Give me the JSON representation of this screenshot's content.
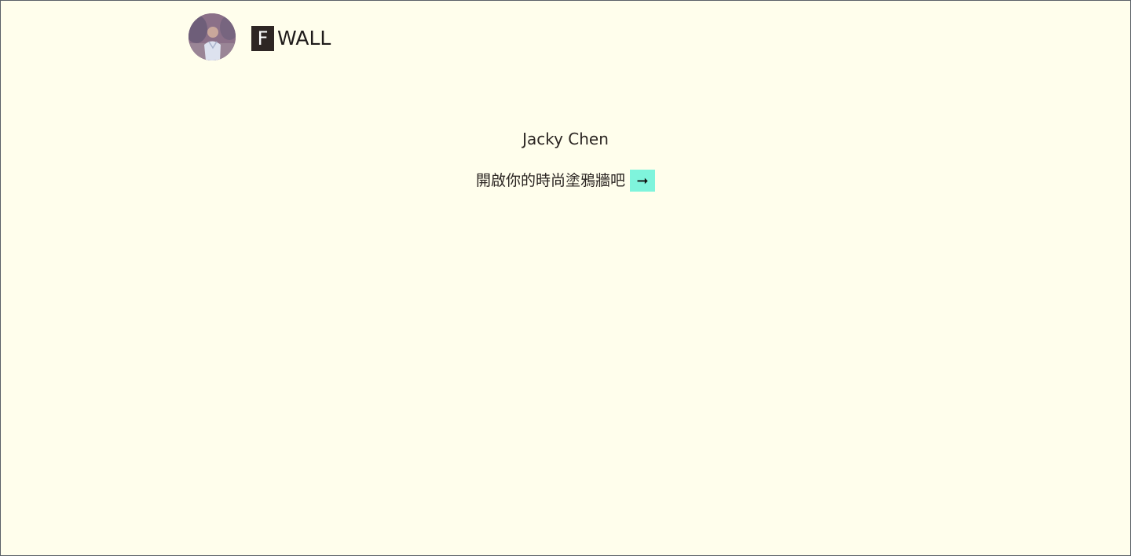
{
  "header": {
    "avatar_icon": "user-photo",
    "logo": {
      "letter": "F",
      "text": "WALL"
    }
  },
  "profile": {
    "name": "Jacky Chen"
  },
  "cta": {
    "text": "開啟你的時尚塗鴉牆吧",
    "button_icon": "arrow-right-icon",
    "button_glyph": "➞"
  },
  "colors": {
    "background": "#fffeec",
    "text": "#2b2522",
    "logo_box": "#2e2624",
    "accent": "#7ff4dc"
  }
}
